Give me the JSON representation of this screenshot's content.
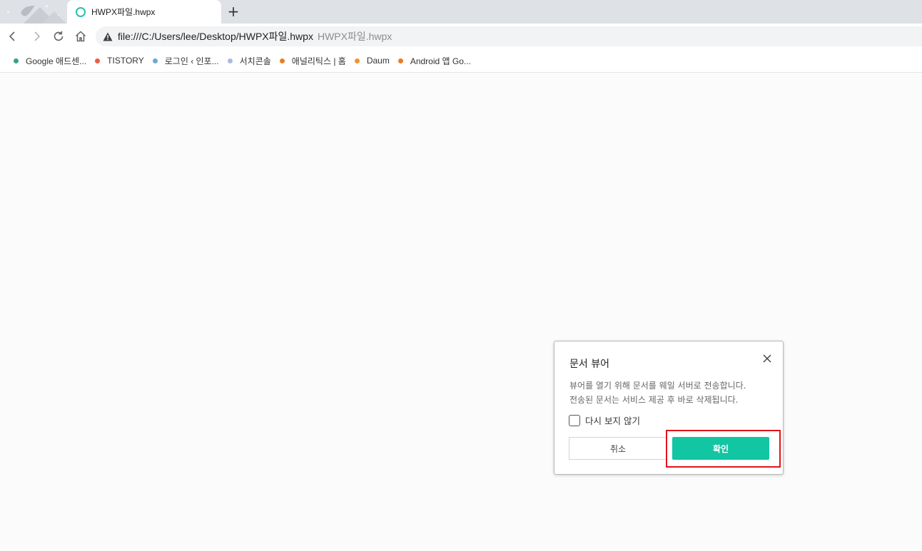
{
  "browser": {
    "tab": {
      "title": "HWPX파일.hwpx"
    },
    "new_tab_symbol": "+",
    "url": "file:///C:/Users/lee/Desktop/HWPX파일.hwpx",
    "url_page_title": "HWPX파일.hwpx"
  },
  "bookmarks": [
    {
      "label": "Google 애드센...",
      "color": "#3a9e8a"
    },
    {
      "label": "TISTORY",
      "color": "#ef5b46"
    },
    {
      "label": "로그인 ‹ 인포...",
      "color": "#6fa8d2"
    },
    {
      "label": "서치콘솔",
      "color": "#a9bbdf"
    },
    {
      "label": "애널리틱스 | 홈",
      "color": "#e8801f"
    },
    {
      "label": "Daum",
      "color": "#f0962e"
    },
    {
      "label": "Android 앱 Go...",
      "color": "#ea7b25"
    }
  ],
  "dialog": {
    "title": "문서 뷰어",
    "message_line1": "뷰어를 열기 위해 문서를 웨일 서버로 전송합니다.",
    "message_line2": "전송된 문서는 서비스 제공 후 바로 삭제됩니다.",
    "checkbox_label": "다시 보지 않기",
    "cancel_label": "취소",
    "ok_label": "확인"
  },
  "colors": {
    "accent": "#12c5a3",
    "highlight": "#e3131b"
  }
}
